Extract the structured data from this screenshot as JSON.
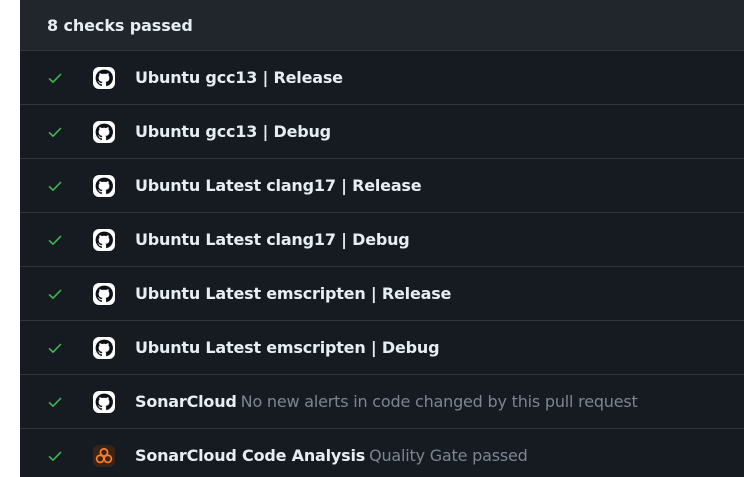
{
  "header": {
    "title": "8 checks passed"
  },
  "colors": {
    "background": "#161b22",
    "header_background": "#21262d",
    "divider": "#30363d",
    "success": "#3fb950",
    "text_primary": "#e6edf3",
    "text_muted": "#7d8590",
    "sonar_orange": "#f47c29"
  },
  "checks": [
    {
      "status": "passed",
      "status_icon": "check-icon",
      "app_icon": "github-icon",
      "name": "Ubuntu gcc13 | Release",
      "description": ""
    },
    {
      "status": "passed",
      "status_icon": "check-icon",
      "app_icon": "github-icon",
      "name": "Ubuntu gcc13 | Debug",
      "description": ""
    },
    {
      "status": "passed",
      "status_icon": "check-icon",
      "app_icon": "github-icon",
      "name": "Ubuntu Latest clang17 | Release",
      "description": ""
    },
    {
      "status": "passed",
      "status_icon": "check-icon",
      "app_icon": "github-icon",
      "name": "Ubuntu Latest clang17 | Debug",
      "description": ""
    },
    {
      "status": "passed",
      "status_icon": "check-icon",
      "app_icon": "github-icon",
      "name": "Ubuntu Latest emscripten | Release",
      "description": ""
    },
    {
      "status": "passed",
      "status_icon": "check-icon",
      "app_icon": "github-icon",
      "name": "Ubuntu Latest emscripten | Debug",
      "description": ""
    },
    {
      "status": "passed",
      "status_icon": "check-icon",
      "app_icon": "github-icon",
      "name": "SonarCloud",
      "description": "No new alerts in code changed by this pull request"
    },
    {
      "status": "passed",
      "status_icon": "check-icon",
      "app_icon": "sonarcloud-icon",
      "name": "SonarCloud Code Analysis",
      "description": "Quality Gate passed"
    }
  ]
}
